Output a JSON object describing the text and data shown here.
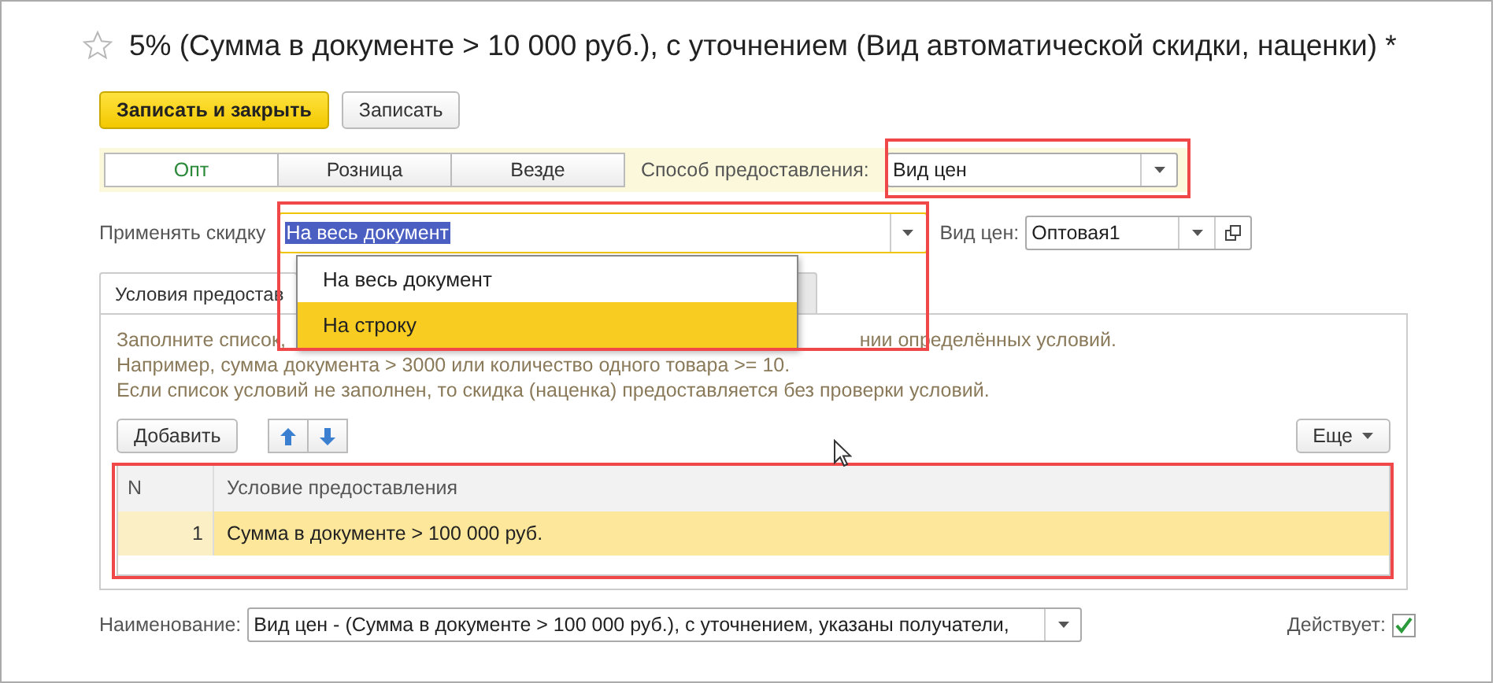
{
  "title": "5% (Сумма в документе > 10 000 руб.), с уточнением (Вид автоматической скидки, наценки) *",
  "toolbar": [
    {
      "label": "Записать и закрыть",
      "kind": "primary"
    },
    {
      "label": "Записать",
      "kind": "default"
    }
  ],
  "scope_tabs": [
    {
      "label": "Опт",
      "selected": true
    },
    {
      "label": "Розница",
      "selected": false
    },
    {
      "label": "Везде",
      "selected": false
    }
  ],
  "provision_method": {
    "label": "Способ предоставления:",
    "value": "Вид цен"
  },
  "apply_discount": {
    "label": "Применять скидку",
    "value": "На весь документ",
    "value_selected": true
  },
  "dropdown": [
    {
      "label": "На весь документ",
      "selected": false
    },
    {
      "label": "На строку",
      "selected": true
    }
  ],
  "price_type": {
    "label": "Вид цен:",
    "value": "Оптовая1"
  },
  "tabs": [
    {
      "label": "Условия предостав",
      "selected": true
    }
  ],
  "hint": {
    "line_1_left": "Заполните список,",
    "line_1_right": "нии определённых условий.",
    "line_2": "Например, сумма документа > 3000 или количество одного товара >= 10.",
    "line_3": "Если список условий не заполнен, то скидка (наценка) предоставляется без проверки условий."
  },
  "table_buttons": {
    "add": "Добавить",
    "more": "Еще"
  },
  "table": {
    "columns": [
      "N",
      "Условие предоставления"
    ],
    "rows": [
      {
        "n": "1",
        "condition": "Сумма в документе > 100 000 руб.",
        "selected": true
      }
    ]
  },
  "name": {
    "label": "Наименование:",
    "value": "Вид цен -  (Сумма в документе > 100 000 руб.), с уточнением, указаны получатели,"
  },
  "active": {
    "label": "Действует:",
    "checked": true
  }
}
